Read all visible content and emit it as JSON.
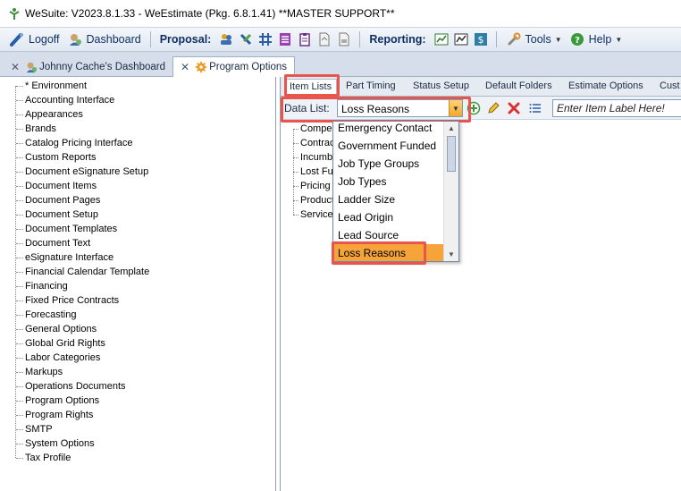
{
  "window": {
    "title": "WeSuite: V2023.8.1.33 - WeEstimate (Pkg. 6.8.1.41) **MASTER SUPPORT**"
  },
  "toolbar": {
    "logoff": "Logoff",
    "dashboard": "Dashboard",
    "proposal_label": "Proposal:",
    "reporting_label": "Reporting:",
    "tools": "Tools",
    "help": "Help"
  },
  "doc_tabs": [
    {
      "label": "Johnny Cache's Dashboard"
    },
    {
      "label": "Program Options"
    }
  ],
  "tree": {
    "items": [
      "* Environment",
      "Accounting Interface",
      "Appearances",
      "Brands",
      "Catalog Pricing Interface",
      "Custom Reports",
      "Document eSignature Setup",
      "Document Items",
      "Document Pages",
      "Document Setup",
      "Document Templates",
      "Document Text",
      "eSignature Interface",
      "Financial Calendar Template",
      "Financing",
      "Fixed Price Contracts",
      "Forecasting",
      "General Options",
      "Global Grid Rights",
      "Labor Categories",
      "Markups",
      "Operations Documents",
      "Program Options",
      "Program Rights",
      "SMTP",
      "System Options",
      "Tax Profile"
    ]
  },
  "sub_tabs": [
    "Item Lists",
    "Part Timing",
    "Status Setup",
    "Default Folders",
    "Estimate Options",
    "Cust"
  ],
  "data_list": {
    "label": "Data List:",
    "selected": "Loss Reasons",
    "item_label_placeholder": "Enter Item Label Here!"
  },
  "list_items": [
    "Compe",
    "Contrac",
    "Incumb",
    "Lost Fu",
    "Pricing",
    "Product",
    "Service"
  ],
  "dropdown": {
    "options": [
      "Emergency Contact",
      "Government Funded",
      "Job Type Groups",
      "Job Types",
      "Ladder Size",
      "Lead Origin",
      "Lead Source",
      "Loss Reasons"
    ],
    "selected_index": 7
  },
  "colors": {
    "highlight": "#e8554e",
    "selection": "#f6a43a",
    "toolbar_text": "#0f2f63"
  }
}
